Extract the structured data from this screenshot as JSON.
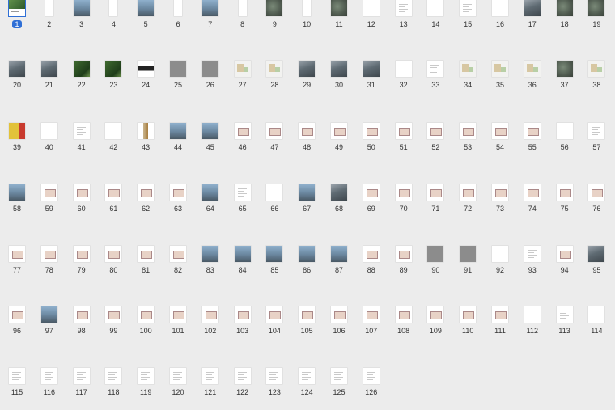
{
  "selected_page": 1,
  "pages": [
    {
      "n": "1",
      "kind": "cover"
    },
    {
      "n": "2",
      "kind": "white-slim"
    },
    {
      "n": "3",
      "kind": "sky"
    },
    {
      "n": "4",
      "kind": "white-slim"
    },
    {
      "n": "5",
      "kind": "sky"
    },
    {
      "n": "6",
      "kind": "white-slim"
    },
    {
      "n": "7",
      "kind": "sky"
    },
    {
      "n": "8",
      "kind": "white-slim"
    },
    {
      "n": "9",
      "kind": "aerial"
    },
    {
      "n": "10",
      "kind": "white-slim"
    },
    {
      "n": "11",
      "kind": "aerial"
    },
    {
      "n": "12",
      "kind": "white"
    },
    {
      "n": "13",
      "kind": "doc"
    },
    {
      "n": "14",
      "kind": "white"
    },
    {
      "n": "15",
      "kind": "doc"
    },
    {
      "n": "16",
      "kind": "white"
    },
    {
      "n": "17",
      "kind": "photo"
    },
    {
      "n": "18",
      "kind": "aerial"
    },
    {
      "n": "19",
      "kind": "aerial"
    },
    {
      "n": "20",
      "kind": "photo"
    },
    {
      "n": "21",
      "kind": "photo"
    },
    {
      "n": "22",
      "kind": "green"
    },
    {
      "n": "23",
      "kind": "green"
    },
    {
      "n": "24",
      "kind": "dark"
    },
    {
      "n": "25",
      "kind": "gray"
    },
    {
      "n": "26",
      "kind": "gray"
    },
    {
      "n": "27",
      "kind": "map"
    },
    {
      "n": "28",
      "kind": "map"
    },
    {
      "n": "29",
      "kind": "photo"
    },
    {
      "n": "30",
      "kind": "photo"
    },
    {
      "n": "31",
      "kind": "photo"
    },
    {
      "n": "32",
      "kind": "white"
    },
    {
      "n": "33",
      "kind": "doc"
    },
    {
      "n": "34",
      "kind": "map"
    },
    {
      "n": "35",
      "kind": "map"
    },
    {
      "n": "36",
      "kind": "map"
    },
    {
      "n": "37",
      "kind": "aerial"
    },
    {
      "n": "38",
      "kind": "map"
    },
    {
      "n": "39",
      "kind": "yellow"
    },
    {
      "n": "40",
      "kind": "white"
    },
    {
      "n": "41",
      "kind": "doc"
    },
    {
      "n": "42",
      "kind": "white"
    },
    {
      "n": "43",
      "kind": "tower"
    },
    {
      "n": "44",
      "kind": "sky"
    },
    {
      "n": "45",
      "kind": "sky"
    },
    {
      "n": "46",
      "kind": "plan"
    },
    {
      "n": "47",
      "kind": "plan"
    },
    {
      "n": "48",
      "kind": "plan"
    },
    {
      "n": "49",
      "kind": "plan"
    },
    {
      "n": "50",
      "kind": "plan"
    },
    {
      "n": "51",
      "kind": "plan"
    },
    {
      "n": "52",
      "kind": "plan"
    },
    {
      "n": "53",
      "kind": "plan"
    },
    {
      "n": "54",
      "kind": "plan"
    },
    {
      "n": "55",
      "kind": "plan"
    },
    {
      "n": "56",
      "kind": "white"
    },
    {
      "n": "57",
      "kind": "doc"
    },
    {
      "n": "58",
      "kind": "sky"
    },
    {
      "n": "59",
      "kind": "plan"
    },
    {
      "n": "60",
      "kind": "plan"
    },
    {
      "n": "61",
      "kind": "plan"
    },
    {
      "n": "62",
      "kind": "plan"
    },
    {
      "n": "63",
      "kind": "plan"
    },
    {
      "n": "64",
      "kind": "sky"
    },
    {
      "n": "65",
      "kind": "doc"
    },
    {
      "n": "66",
      "kind": "white"
    },
    {
      "n": "67",
      "kind": "sky"
    },
    {
      "n": "68",
      "kind": "photo"
    },
    {
      "n": "69",
      "kind": "plan"
    },
    {
      "n": "70",
      "kind": "plan"
    },
    {
      "n": "71",
      "kind": "plan"
    },
    {
      "n": "72",
      "kind": "plan"
    },
    {
      "n": "73",
      "kind": "plan"
    },
    {
      "n": "74",
      "kind": "plan"
    },
    {
      "n": "75",
      "kind": "plan"
    },
    {
      "n": "76",
      "kind": "plan"
    },
    {
      "n": "77",
      "kind": "plan"
    },
    {
      "n": "78",
      "kind": "plan"
    },
    {
      "n": "79",
      "kind": "plan"
    },
    {
      "n": "80",
      "kind": "plan"
    },
    {
      "n": "81",
      "kind": "plan"
    },
    {
      "n": "82",
      "kind": "plan"
    },
    {
      "n": "83",
      "kind": "sky"
    },
    {
      "n": "84",
      "kind": "sky"
    },
    {
      "n": "85",
      "kind": "sky"
    },
    {
      "n": "86",
      "kind": "sky"
    },
    {
      "n": "87",
      "kind": "sky"
    },
    {
      "n": "88",
      "kind": "plan"
    },
    {
      "n": "89",
      "kind": "plan"
    },
    {
      "n": "90",
      "kind": "gray"
    },
    {
      "n": "91",
      "kind": "gray"
    },
    {
      "n": "92",
      "kind": "white"
    },
    {
      "n": "93",
      "kind": "doc"
    },
    {
      "n": "94",
      "kind": "plan"
    },
    {
      "n": "95",
      "kind": "photo"
    },
    {
      "n": "96",
      "kind": "plan"
    },
    {
      "n": "97",
      "kind": "sky"
    },
    {
      "n": "98",
      "kind": "plan"
    },
    {
      "n": "99",
      "kind": "plan"
    },
    {
      "n": "100",
      "kind": "plan"
    },
    {
      "n": "101",
      "kind": "plan"
    },
    {
      "n": "102",
      "kind": "plan"
    },
    {
      "n": "103",
      "kind": "plan"
    },
    {
      "n": "104",
      "kind": "plan"
    },
    {
      "n": "105",
      "kind": "plan"
    },
    {
      "n": "106",
      "kind": "plan"
    },
    {
      "n": "107",
      "kind": "plan"
    },
    {
      "n": "108",
      "kind": "plan"
    },
    {
      "n": "109",
      "kind": "plan"
    },
    {
      "n": "110",
      "kind": "plan"
    },
    {
      "n": "111",
      "kind": "plan"
    },
    {
      "n": "112",
      "kind": "white"
    },
    {
      "n": "113",
      "kind": "doc"
    },
    {
      "n": "114",
      "kind": "white"
    },
    {
      "n": "115",
      "kind": "doc"
    },
    {
      "n": "116",
      "kind": "doc"
    },
    {
      "n": "117",
      "kind": "doc"
    },
    {
      "n": "118",
      "kind": "doc"
    },
    {
      "n": "119",
      "kind": "doc"
    },
    {
      "n": "120",
      "kind": "doc"
    },
    {
      "n": "121",
      "kind": "doc"
    },
    {
      "n": "122",
      "kind": "doc"
    },
    {
      "n": "123",
      "kind": "doc"
    },
    {
      "n": "124",
      "kind": "doc"
    },
    {
      "n": "125",
      "kind": "doc"
    },
    {
      "n": "126",
      "kind": "doc"
    }
  ],
  "colors": {
    "background": "#ececec",
    "selection": "#2f6fd6"
  }
}
